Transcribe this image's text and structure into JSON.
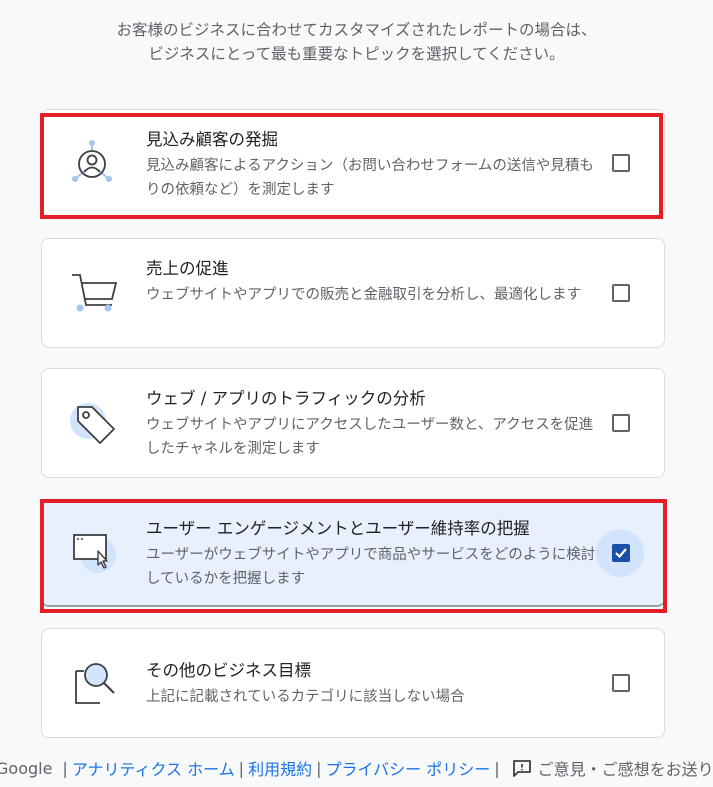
{
  "intro": {
    "line1": "お客様のビジネスに合わせてカスタマイズされたレポートの場合は、",
    "line2": "ビジネスにとって最も重要なトピックを選択してください。"
  },
  "options": [
    {
      "title": "見込み顧客の発掘",
      "desc": "見込み顧客によるアクション（お問い合わせフォームの送信や見積もりの依頼など）を測定します",
      "checked": false,
      "icon": "lead-target-icon"
    },
    {
      "title": "売上の促進",
      "desc": "ウェブサイトやアプリでの販売と金融取引を分析し、最適化します",
      "checked": false,
      "icon": "shopping-cart-icon"
    },
    {
      "title": "ウェブ / アプリのトラフィックの分析",
      "desc": "ウェブサイトやアプリにアクセスしたユーザー数と、アクセスを促進したチャネルを測定します",
      "checked": false,
      "icon": "price-tag-icon"
    },
    {
      "title": "ユーザー エンゲージメントとユーザー維持率の把握",
      "desc": "ユーザーがウェブサイトやアプリで商品やサービスをどのように検討しているかを把握します",
      "checked": true,
      "icon": "browser-cursor-icon"
    },
    {
      "title": "その他のビジネス目標",
      "desc": "上記に記載されているカテゴリに該当しない場合",
      "checked": false,
      "icon": "magnifier-document-icon"
    }
  ],
  "footer": {
    "brand": "Google",
    "sep": "|",
    "links": [
      "アナリティクス ホーム",
      "利用規約",
      "プライバシー ポリシー"
    ],
    "feedback": "ご意見・ご感想をお送り"
  },
  "colors": {
    "accent": "#1a73e8",
    "checkbox_checked": "#1a4fa8",
    "highlight": "#e21f26",
    "selected_bg": "#e8f0fe"
  }
}
